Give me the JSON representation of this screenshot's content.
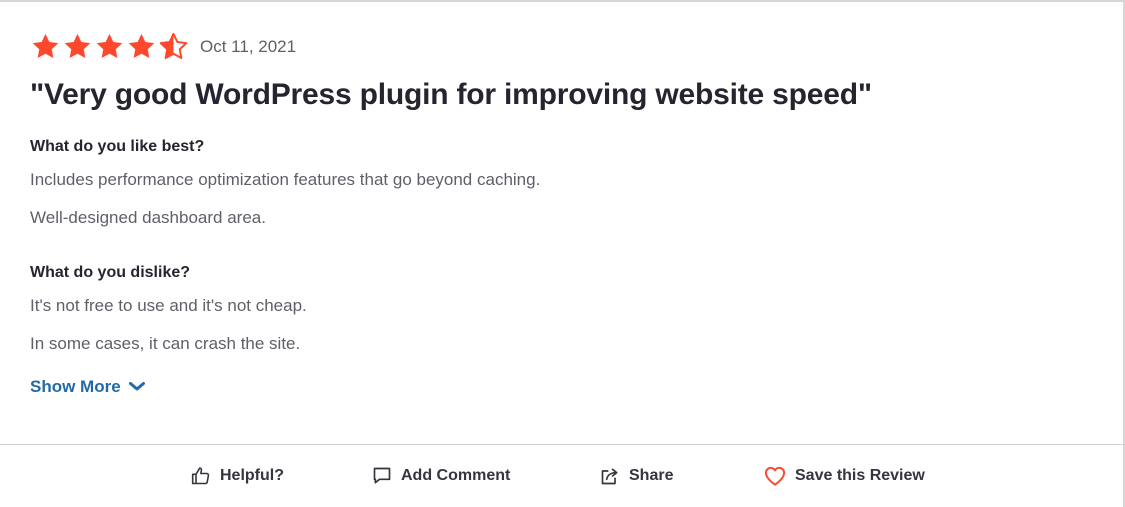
{
  "review": {
    "rating": 4.5,
    "rating_max": 5,
    "star_color": "#ff492c",
    "date": "Oct 11, 2021",
    "title": "\"Very good WordPress plugin for improving website speed\"",
    "like": {
      "question": "What do you like best?",
      "answers": [
        "Includes performance optimization features that go beyond caching.",
        "Well-designed dashboard area."
      ]
    },
    "dislike": {
      "question": "What do you dislike?",
      "answers": [
        "It's not free to use and it's not cheap.",
        "In some cases, it can crash the site."
      ]
    },
    "show_more": "Show More"
  },
  "actions": {
    "helpful": {
      "label": "Helpful?",
      "icon": "thumbs-up-icon"
    },
    "comment": {
      "label": "Add Comment",
      "icon": "comment-icon"
    },
    "share": {
      "label": "Share",
      "icon": "share-icon"
    },
    "save": {
      "label": "Save this Review",
      "icon": "heart-icon",
      "icon_color": "#ff492c"
    }
  },
  "colors": {
    "link": "#236aa7",
    "muted_text": "#5f5f68"
  }
}
